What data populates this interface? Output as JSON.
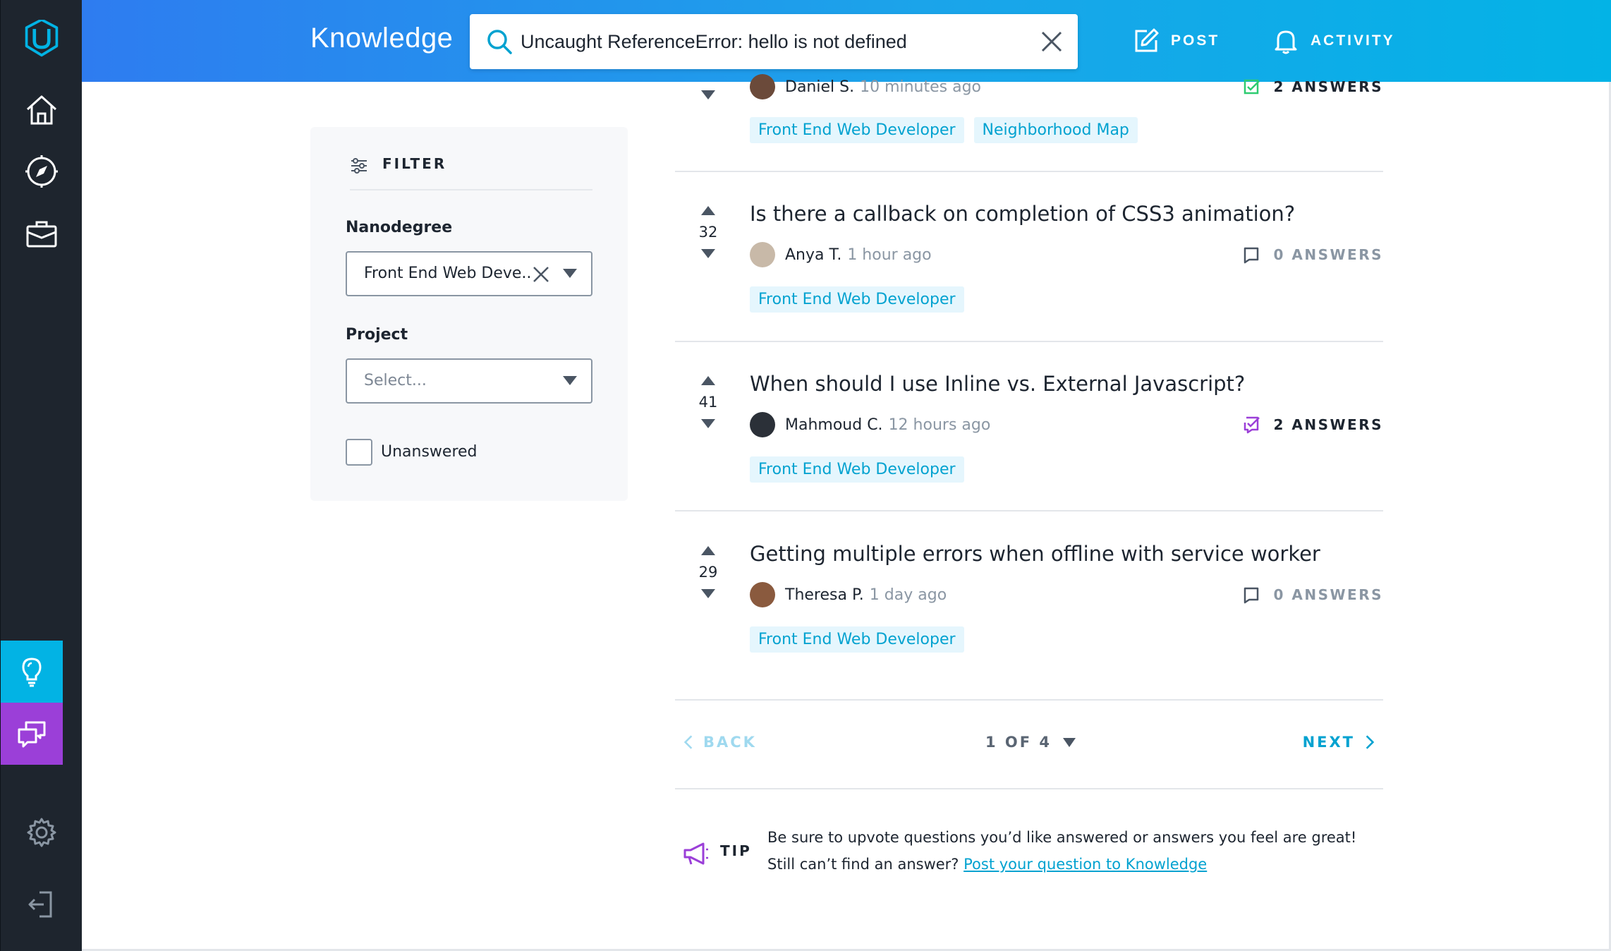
{
  "app": {
    "brand": "Knowledge"
  },
  "search": {
    "value": "Uncaught ReferenceError: hello is not defined",
    "placeholder": ""
  },
  "top_actions": {
    "post": "POST",
    "activity": "ACTIVITY"
  },
  "sidebar": {
    "items": [
      {
        "name": "home",
        "icon": "home-icon"
      },
      {
        "name": "explore",
        "icon": "compass-icon"
      },
      {
        "name": "careers",
        "icon": "briefcase-icon"
      },
      {
        "name": "knowledge",
        "icon": "lightbulb-icon",
        "active": true
      },
      {
        "name": "chat",
        "icon": "chat-icon"
      },
      {
        "name": "settings",
        "icon": "gear-icon"
      },
      {
        "name": "logout",
        "icon": "logout-icon"
      }
    ]
  },
  "filter": {
    "title": "FILTER",
    "nanodegree_label": "Nanodegree",
    "nanodegree_value": "Front End Web Deve...",
    "project_label": "Project",
    "project_placeholder": "Select...",
    "unanswered_label": "Unanswered",
    "unanswered_checked": false
  },
  "questions": [
    {
      "title": "",
      "author": "Daniel S.",
      "time": "10 minutes ago",
      "answers": "2 ANSWERS",
      "answered": true,
      "answer_color": "#2ecc71",
      "tags": [
        "Front End Web Developer",
        "Neighborhood Map"
      ]
    },
    {
      "title": "Is there a callback on completion of CSS3 animation?",
      "votes": "32",
      "author": "Anya T.",
      "time": "1 hour ago",
      "answers": "0 ANSWERS",
      "answered": false,
      "tags": [
        "Front End Web Developer"
      ]
    },
    {
      "title": "When should I use Inline vs. External Javascript?",
      "votes": "41",
      "author": "Mahmoud C.",
      "time": "12 hours ago",
      "answers": "2 ANSWERS",
      "answered": true,
      "answer_color": "#9b3fd8",
      "tags": [
        "Front End Web Developer"
      ]
    },
    {
      "title": "Getting multiple errors when offline with service worker",
      "votes": "29",
      "author": "Theresa P.",
      "time": "1 day ago",
      "answers": "0 ANSWERS",
      "answered": false,
      "tags": [
        "Front End Web Developer"
      ]
    }
  ],
  "pagination": {
    "back": "BACK",
    "page": "1 OF 4",
    "next": "NEXT"
  },
  "tip": {
    "label": "TIP",
    "line1": "Be sure to upvote questions you’d like answered or answers you feel are great!",
    "line2_prefix": "Still can’t find an answer? ",
    "link": "Post your question to Knowledge"
  },
  "colors": {
    "accent": "#02b3e4",
    "purple": "#9b3fd8",
    "sidebar": "#1e252e",
    "tag_bg": "#e5f6fd",
    "tag_text": "#02a2d0"
  }
}
